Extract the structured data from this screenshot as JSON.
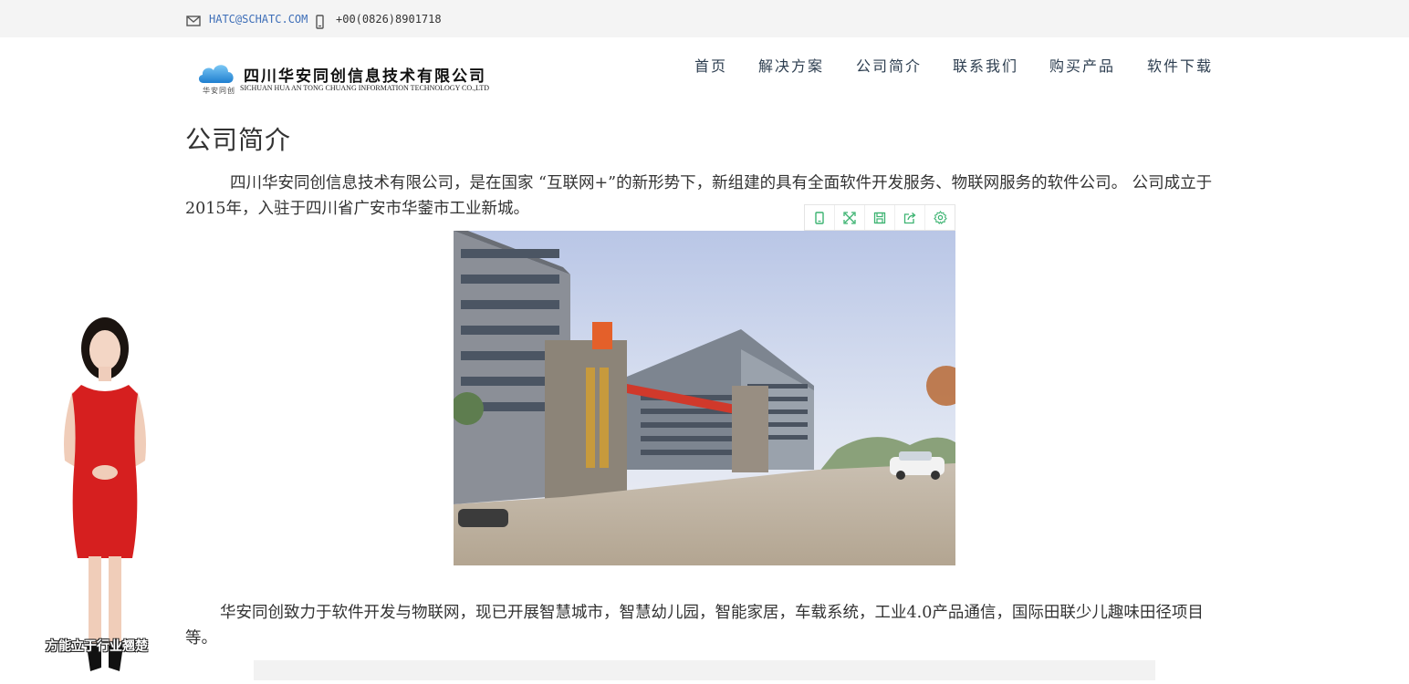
{
  "topbar": {
    "email": "HATC@SCHATC.COM",
    "phone": "+00(0826)8901718",
    "email_icon": "mail-icon",
    "phone_icon": "mobile-phone-icon"
  },
  "logo": {
    "name_cn": "四川华安同创信息技术有限公司",
    "name_en": "SICHUAN HUA AN TONG CHUANG INFORMATION TECHNOLOGY CO.,LTD",
    "badge_text": "华安同创"
  },
  "nav": [
    {
      "label": "首页"
    },
    {
      "label": "解决方案"
    },
    {
      "label": "公司简介"
    },
    {
      "label": "联系我们"
    },
    {
      "label": "购买产品"
    },
    {
      "label": "软件下载"
    }
  ],
  "main": {
    "title": "公司简介",
    "paragraph1": "四川华安同创信息技术有限公司，是在国家 “互联网+”的新形势下，新组建的具有全面软件开发服务、物联网服务的软件公司。 公司成立于2015年，入驻于四川省广安市华蓥市工业新城。",
    "paragraph2": "华安同创致力于软件开发与物联网，现已开展智慧城市，智慧幼儿园，智能家居，车载系统，工业4.0产品通信，国际田联少儿趣味田径项目等。"
  },
  "image_toolbar": [
    "copy-icon",
    "fullscreen-icon",
    "save-icon",
    "share-icon",
    "settings-icon"
  ],
  "avatar": {
    "caption": "方能立于行业翘楚"
  },
  "colors": {
    "accent_green": "#3cb371",
    "topbar_bg": "#f4f4f4",
    "email_link": "#3f6fb8",
    "nav_text": "#2d3e50"
  }
}
